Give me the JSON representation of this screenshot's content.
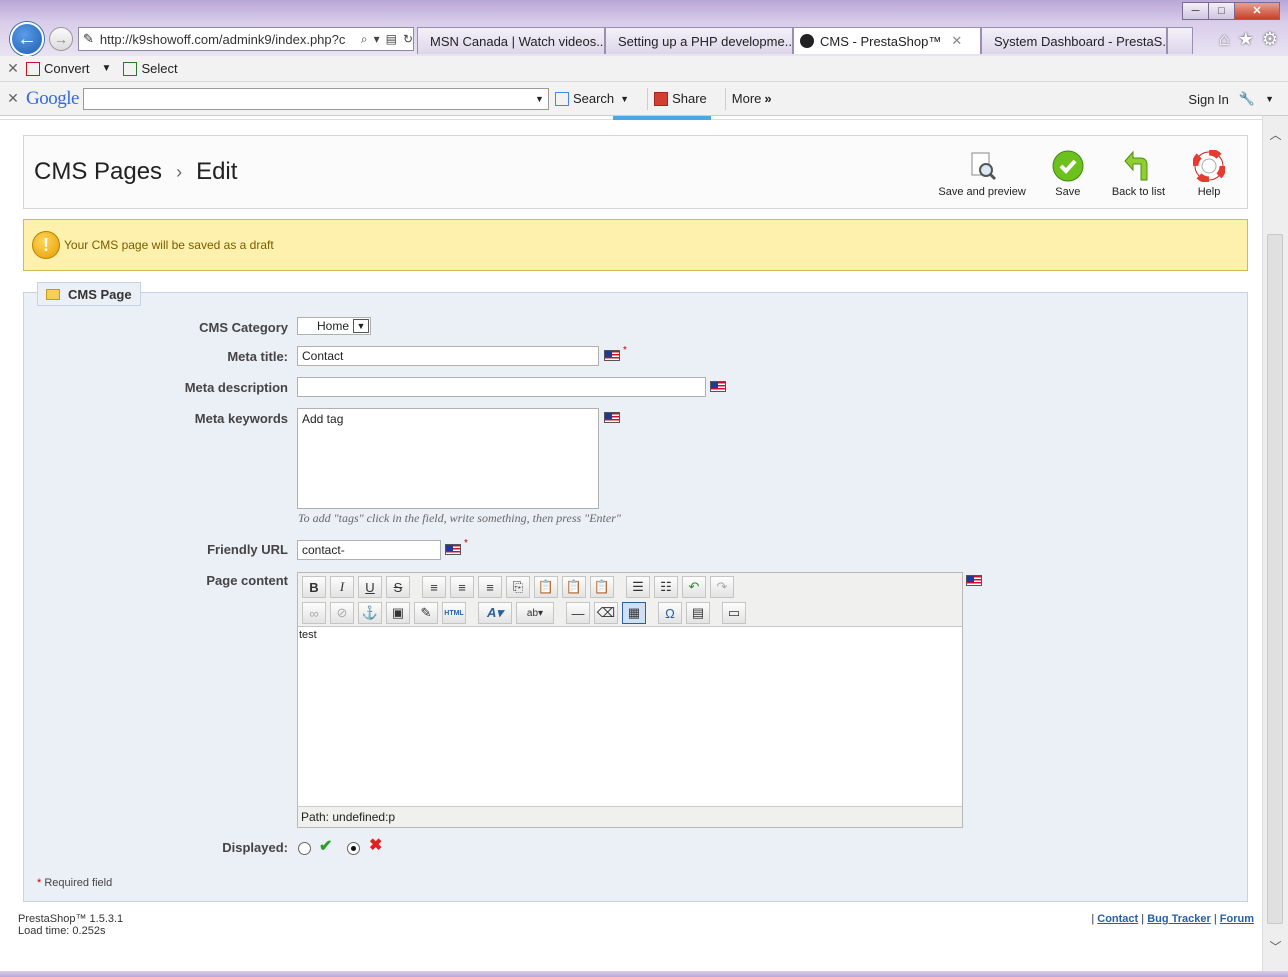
{
  "browser": {
    "window_controls": [
      "─",
      "□",
      "✕"
    ],
    "address": "http://k9showoff.com/admink9/index.php?c",
    "tabs": [
      {
        "title": "MSN Canada | Watch videos...",
        "color": "#3b8fd8"
      },
      {
        "title": "Setting up a PHP developme...",
        "color": "#c4161c"
      },
      {
        "title": "CMS - PrestaShop™",
        "color": "#222222",
        "close": "✕"
      },
      {
        "title": "System Dashboard - PrestaS...",
        "color": "#8bbf3c"
      }
    ],
    "toolbar1": {
      "convert": "Convert",
      "select": "Select"
    },
    "toolbar2": {
      "google": "Google",
      "search": "Search",
      "share": "Share",
      "more": "More",
      "sign_in": "Sign In"
    }
  },
  "header": {
    "crumb_section": "CMS Pages",
    "crumb_page": "Edit",
    "actions": {
      "save_preview": "Save and preview",
      "save": "Save",
      "back": "Back to list",
      "help": "Help"
    }
  },
  "warning": "Your CMS page will be saved as a draft",
  "form": {
    "legend": "CMS Page",
    "category_label": "CMS Category",
    "category_value": "Home",
    "meta_title_label": "Meta title:",
    "meta_title_value": "Contact",
    "meta_desc_label": "Meta description",
    "meta_desc_value": "",
    "meta_keywords_label": "Meta keywords",
    "meta_keywords_value": "Add tag",
    "keywords_hint": "To add \"tags\" click in the field, write something, then press \"Enter\"",
    "friendly_url_label": "Friendly URL",
    "friendly_url_value": "contact-",
    "content_label": "Page content",
    "content_value": "test",
    "editor_path": "Path: undefined:p",
    "displayed_label": "Displayed:",
    "displayed_value": "no",
    "required_star": "*",
    "required_note": "Required field"
  },
  "footer": {
    "version": "PrestaShop™ 1.5.3.1",
    "load_time": "Load time: 0.252s",
    "links": [
      "Contact",
      "Bug Tracker",
      "Forum"
    ]
  }
}
